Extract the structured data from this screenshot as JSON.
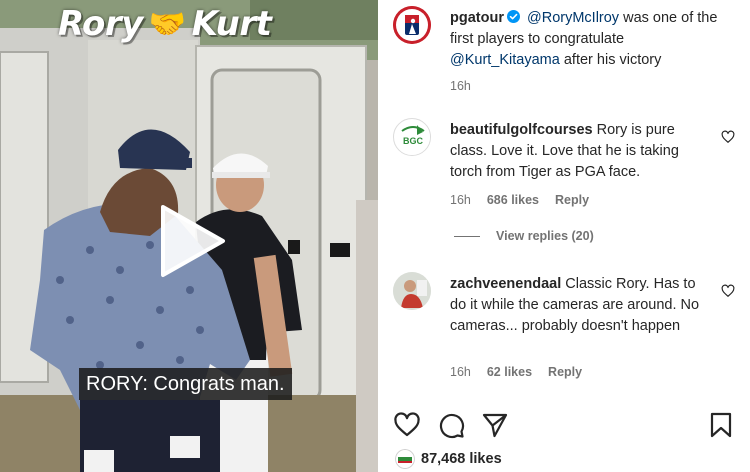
{
  "video": {
    "caption_left": "Rory",
    "caption_right": "Kurt",
    "subtitle": "RORY: Congrats man."
  },
  "post": {
    "author": "pgatour",
    "mention_1": "@RoryMcIlroy",
    "text_1": "was one of the first players to congratulate",
    "mention_2": "@Kurt_Kitayama",
    "text_2": "after his victory",
    "time": "16h"
  },
  "comments": [
    {
      "user": "beautifulgolfcourses",
      "text": "Rory is pure class. Love it. Love that he is taking torch from Tiger as PGA face.",
      "time": "16h",
      "likes": "686 likes",
      "reply": "Reply",
      "avatar_text": "BGC"
    },
    {
      "user": "zachveenendaal",
      "text": "Classic Rory. Has to do it while the cameras are around. No cameras... probably doesn't happen",
      "time": "16h",
      "likes": "62 likes",
      "reply": "Reply"
    }
  ],
  "view_replies": "View replies (20)",
  "likes_total": "87,468 likes",
  "icons": {
    "like": "heart-icon",
    "comment": "comment-icon",
    "share": "share-icon",
    "save": "bookmark-icon"
  },
  "colors": {
    "verified": "#0095f6",
    "mention": "#00376b",
    "meta": "#737373"
  }
}
